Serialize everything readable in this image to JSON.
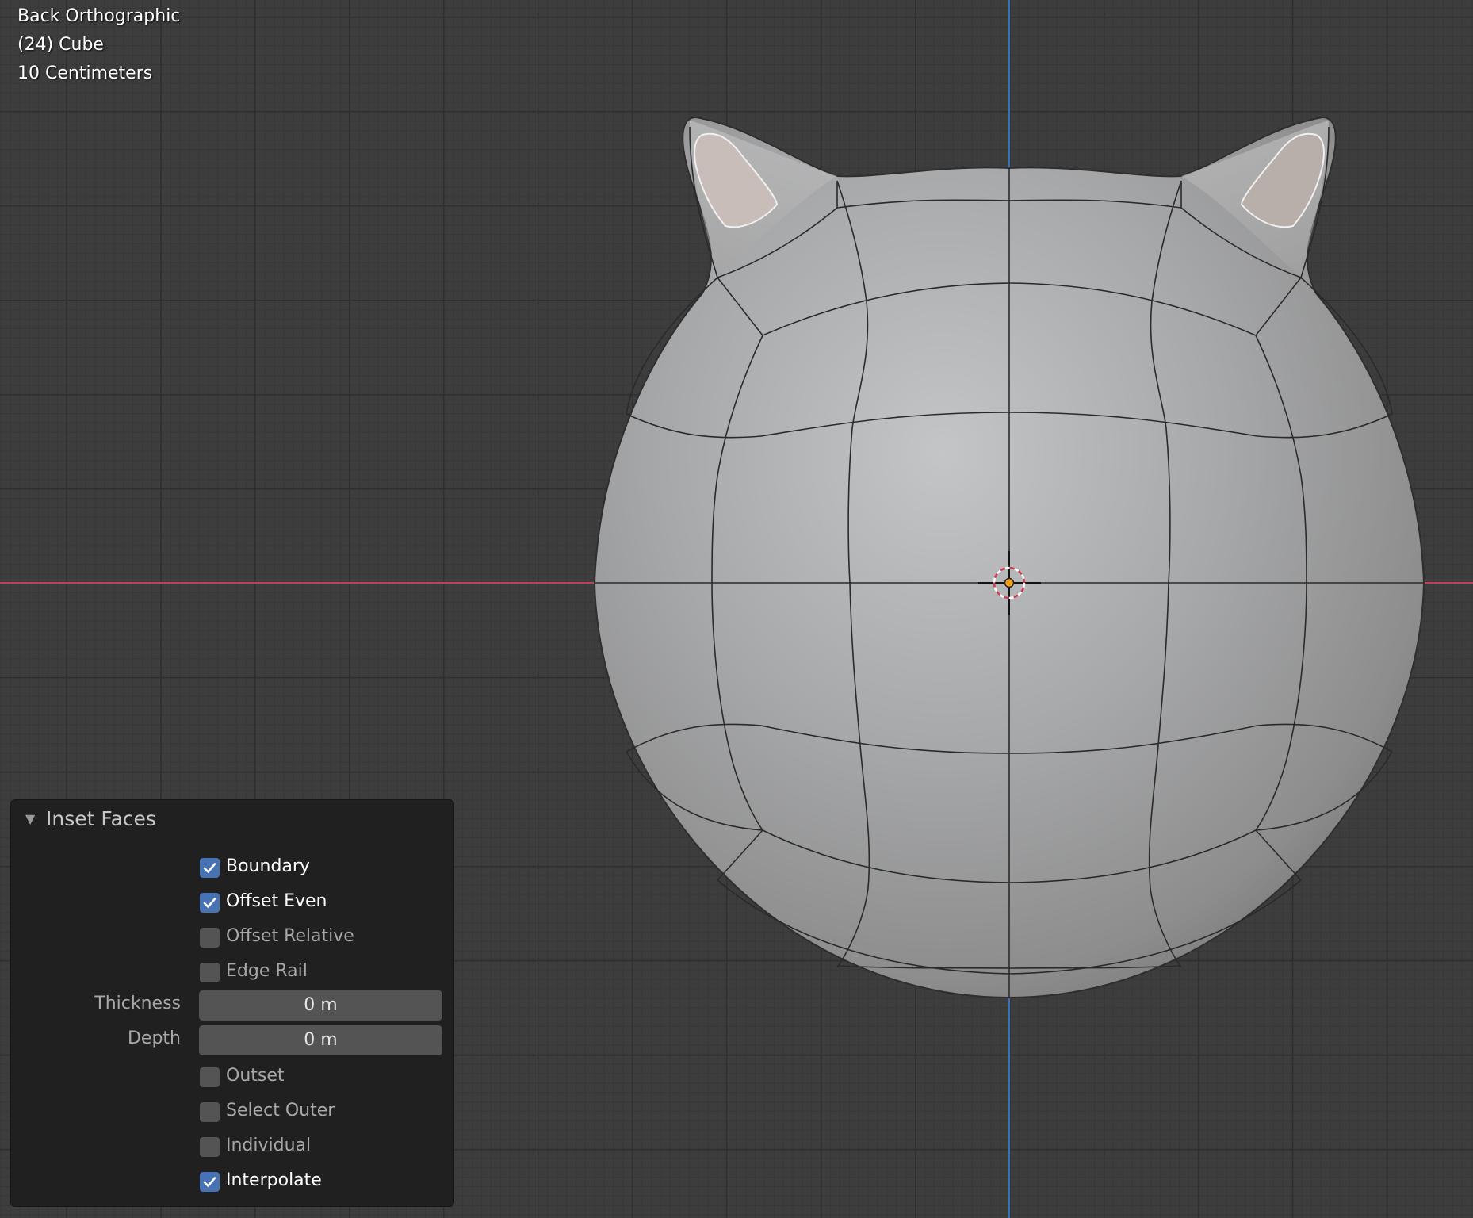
{
  "viewport": {
    "view_name": "Back Orthographic",
    "object_info": "(24) Cube",
    "grid_scale": "10 Centimeters",
    "colors": {
      "background": "#3d3d3d",
      "x_axis": "#c0405a",
      "z_axis": "#3a6fc0",
      "mesh": "#a9a9a9",
      "selected_face": "#c4b8b2"
    }
  },
  "operator_panel": {
    "title": "Inset Faces",
    "collapse_icon": "triangle-down-icon",
    "options": {
      "boundary": {
        "label": "Boundary",
        "checked": true
      },
      "offset_even": {
        "label": "Offset Even",
        "checked": true
      },
      "offset_relative": {
        "label": "Offset Relative",
        "checked": false
      },
      "edge_rail": {
        "label": "Edge Rail",
        "checked": false
      },
      "outset": {
        "label": "Outset",
        "checked": false
      },
      "select_outer": {
        "label": "Select Outer",
        "checked": false
      },
      "individual": {
        "label": "Individual",
        "checked": false
      },
      "interpolate": {
        "label": "Interpolate",
        "checked": true
      }
    },
    "thickness": {
      "label": "Thickness",
      "value": "0 m"
    },
    "depth": {
      "label": "Depth",
      "value": "0 m"
    }
  }
}
